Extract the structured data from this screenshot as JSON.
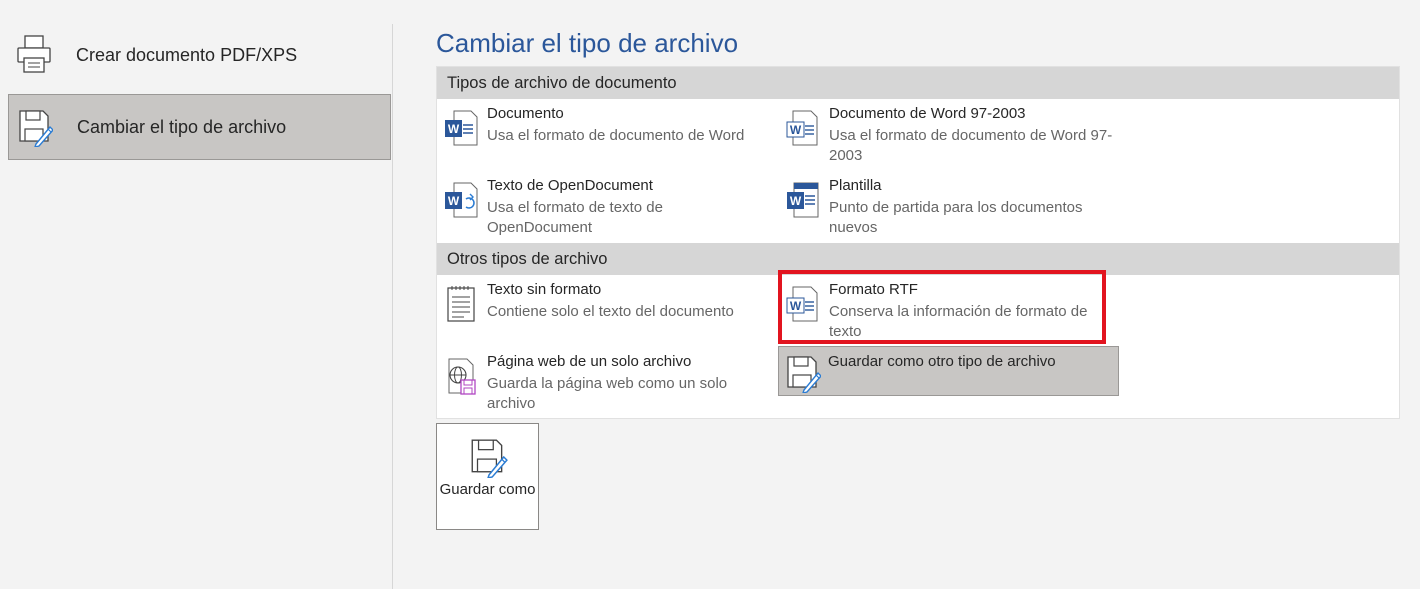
{
  "left_nav": {
    "items": [
      {
        "label": "Crear documento PDF/XPS",
        "icon": "printer-icon"
      },
      {
        "label": "Cambiar el tipo de archivo",
        "icon": "save-edit-icon",
        "selected": true
      }
    ]
  },
  "main": {
    "title": "Cambiar el tipo de archivo",
    "sections": [
      {
        "header": "Tipos de archivo de documento",
        "items": [
          {
            "title": "Documento",
            "description": "Usa el formato de documento de Word",
            "icon": "word-doc-icon"
          },
          {
            "title": "Documento de Word 97-2003",
            "description": "Usa el formato de documento de Word 97-2003",
            "icon": "word-97-icon"
          },
          {
            "title": "Texto de OpenDocument",
            "description": "Usa el formato de texto de OpenDocument",
            "icon": "odt-icon"
          },
          {
            "title": "Plantilla",
            "description": "Punto de partida para los documentos nuevos",
            "icon": "word-template-icon"
          }
        ]
      },
      {
        "header": "Otros tipos de archivo",
        "items": [
          {
            "title": "Texto sin formato",
            "description": "Contiene solo el texto del documento",
            "icon": "plain-text-icon"
          },
          {
            "title": "Formato RTF",
            "description": "Conserva la información de formato de texto",
            "icon": "rtf-icon",
            "highlighted": true
          },
          {
            "title": "Página web de un solo archivo",
            "description": "Guarda la página web como un solo archivo",
            "icon": "web-page-icon"
          },
          {
            "title": "Guardar como otro tipo de archivo",
            "description": "",
            "icon": "save-edit-icon",
            "selected": true
          }
        ]
      }
    ],
    "save_as_button": {
      "label": "Guardar como",
      "icon": "save-edit-icon"
    }
  },
  "colors": {
    "title_blue": "#2b579a",
    "highlight_red": "#e2141f",
    "word_blue": "#2b579a",
    "selected_bg": "#c8c6c4"
  }
}
